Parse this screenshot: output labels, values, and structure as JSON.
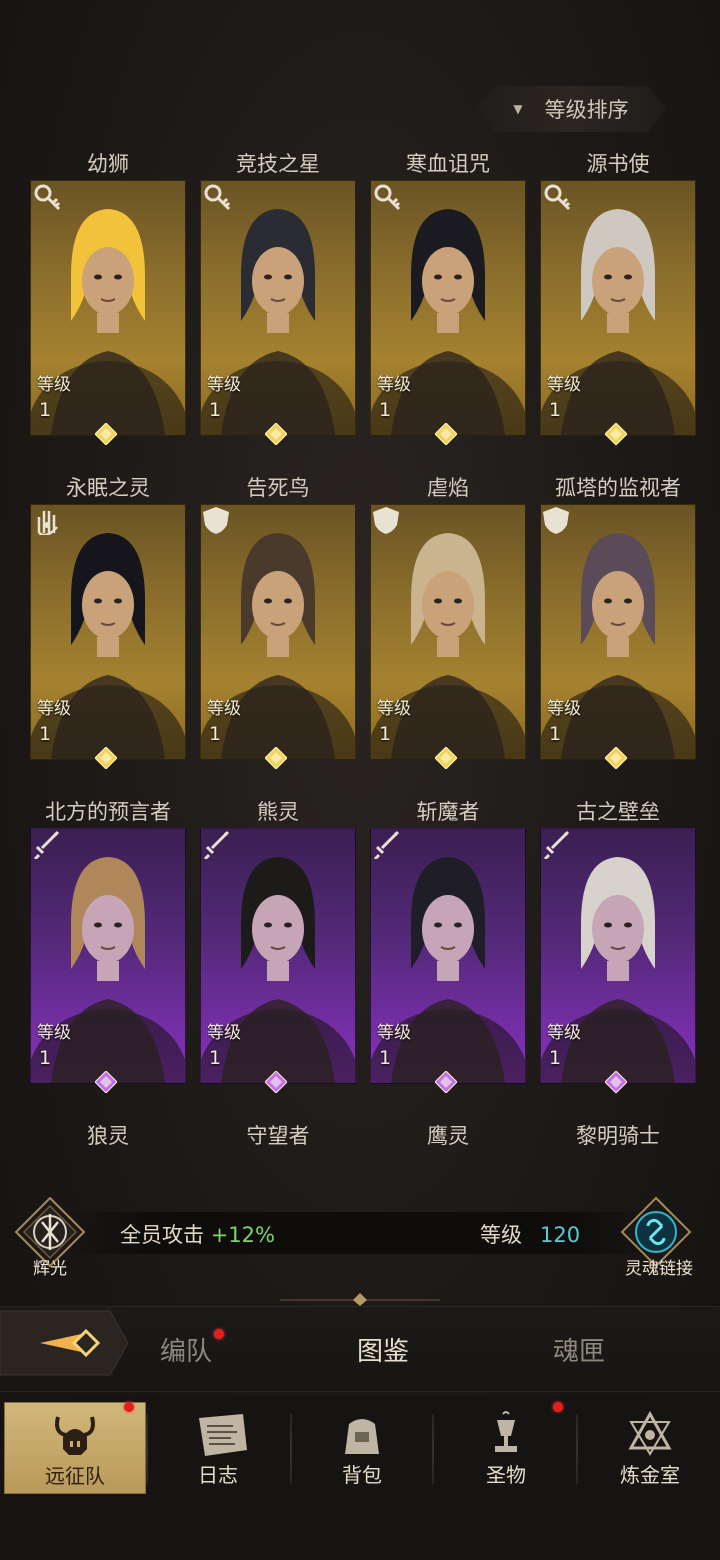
{
  "sort_button": {
    "label": "等级排序",
    "icon": "triangle-down-icon"
  },
  "level_label": "等级",
  "cards": [
    {
      "name": "幼狮",
      "level": "1",
      "rarity": "gold",
      "class_icon": "key-icon"
    },
    {
      "name": "竞技之星",
      "level": "1",
      "rarity": "gold",
      "class_icon": "key-icon"
    },
    {
      "name": "寒血诅咒",
      "level": "1",
      "rarity": "gold",
      "class_icon": "key-icon"
    },
    {
      "name": "源书使",
      "level": "1",
      "rarity": "gold",
      "class_icon": "key-icon"
    },
    {
      "name": "永眠之灵",
      "level": "1",
      "rarity": "gold",
      "class_icon": "palm-icon"
    },
    {
      "name": "告死鸟",
      "level": "1",
      "rarity": "gold",
      "class_icon": "shield-icon"
    },
    {
      "name": "虐焰",
      "level": "1",
      "rarity": "gold",
      "class_icon": "shield-icon"
    },
    {
      "name": "孤塔的监视者",
      "level": "1",
      "rarity": "gold",
      "class_icon": "shield-icon"
    },
    {
      "name": "北方的预言者",
      "level": "1",
      "rarity": "purple",
      "class_icon": "sword-icon"
    },
    {
      "name": "熊灵",
      "level": "1",
      "rarity": "purple",
      "class_icon": "sword-icon"
    },
    {
      "name": "斩魔者",
      "level": "1",
      "rarity": "purple",
      "class_icon": "sword-icon"
    },
    {
      "name": "古之壁垒",
      "level": "1",
      "rarity": "purple",
      "class_icon": "sword-icon"
    }
  ],
  "bottom_names": [
    "狼灵",
    "守望者",
    "鹰灵",
    "黎明骑士"
  ],
  "bonus_bar": {
    "left_emblem_label": "辉光",
    "left_text": "全员攻击",
    "left_bonus": "+12%",
    "right_label": "等级",
    "right_value": "120",
    "right_emblem_label": "灵魂链接"
  },
  "tabs": [
    {
      "label": "编队",
      "badge": true
    },
    {
      "label": "图鉴",
      "active": true
    },
    {
      "label": "魂匣"
    }
  ],
  "nav": [
    {
      "label": "远征队",
      "icon": "viking-helmet-icon",
      "active": true,
      "badge": true
    },
    {
      "label": "日志",
      "icon": "scroll-icon"
    },
    {
      "label": "背包",
      "icon": "bag-icon"
    },
    {
      "label": "圣物",
      "icon": "chalice-icon",
      "badge": true
    },
    {
      "label": "炼金室",
      "icon": "alchemy-icon"
    }
  ],
  "colors": {
    "gold_card": "#9a7a2e",
    "purple_card": "#6b2ba0",
    "bonus_green": "#7fd36a",
    "level_cyan": "#59c9d6",
    "badge_red": "#e0201d"
  }
}
